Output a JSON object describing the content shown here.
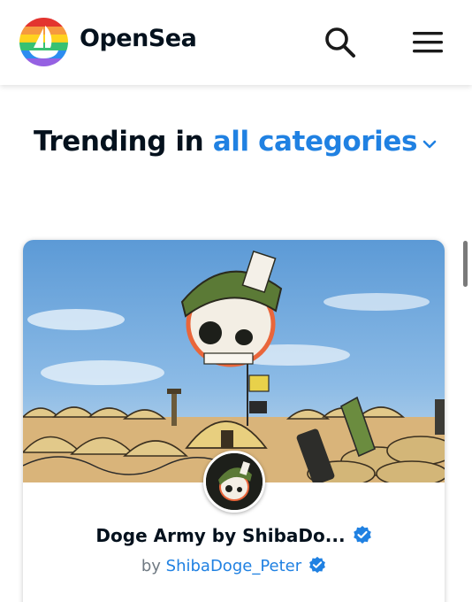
{
  "header": {
    "brand": "OpenSea",
    "icons": {
      "logo": "opensea-rainbow-logo",
      "search": "search-icon",
      "menu": "hamburger-menu-icon"
    }
  },
  "trending": {
    "prefix": "Trending in",
    "category": "all categories",
    "chevron_icon": "chevron-down-icon"
  },
  "collection": {
    "title": "Doge Army by ShibaDo...",
    "by": "by",
    "creator": "ShibaDoge_Peter",
    "verified_icon": "verified-badge-icon"
  },
  "colors": {
    "accent": "#2081e2",
    "text": "#04111d",
    "muted": "#707a83"
  }
}
